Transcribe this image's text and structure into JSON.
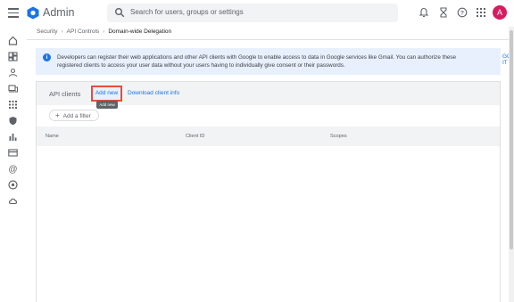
{
  "header": {
    "app_title": "Admin",
    "search_placeholder": "Search for users, groups or settings",
    "avatar_letter": "A",
    "icons": [
      "menu-icon",
      "admin-logo-icon",
      "search-icon",
      "notifications-icon",
      "hourglass-icon",
      "help-icon",
      "apps-icon"
    ]
  },
  "rail": {
    "icons": [
      "home-icon",
      "dashboard-icon",
      "users-icon",
      "devices-icon",
      "apps-icon",
      "security-icon",
      "reports-icon",
      "billing-icon",
      "account-icon",
      "rules-icon",
      "storage-icon"
    ]
  },
  "breadcrumb": {
    "items": [
      "Security",
      "API Controls",
      "Domain-wide Delegation"
    ],
    "separator": "›"
  },
  "banner": {
    "message": "Developers can register their web applications and other API clients with Google to enable access to data in Google services like Gmail. You can authorize these registered clients to access your user data without your users having to individually give consent or their passwords.",
    "action": "GOT IT"
  },
  "card": {
    "title": "API clients",
    "add_new": "Add new",
    "tooltip": "Add new",
    "download": "Download client info",
    "filter": "Add a filter",
    "columns": [
      "Name",
      "Client ID",
      "Scopes"
    ]
  },
  "colors": {
    "accent": "#1a73e8",
    "highlight_border": "#e74c3c",
    "avatar": "#d81b60",
    "banner_bg": "#e8f0fe"
  }
}
